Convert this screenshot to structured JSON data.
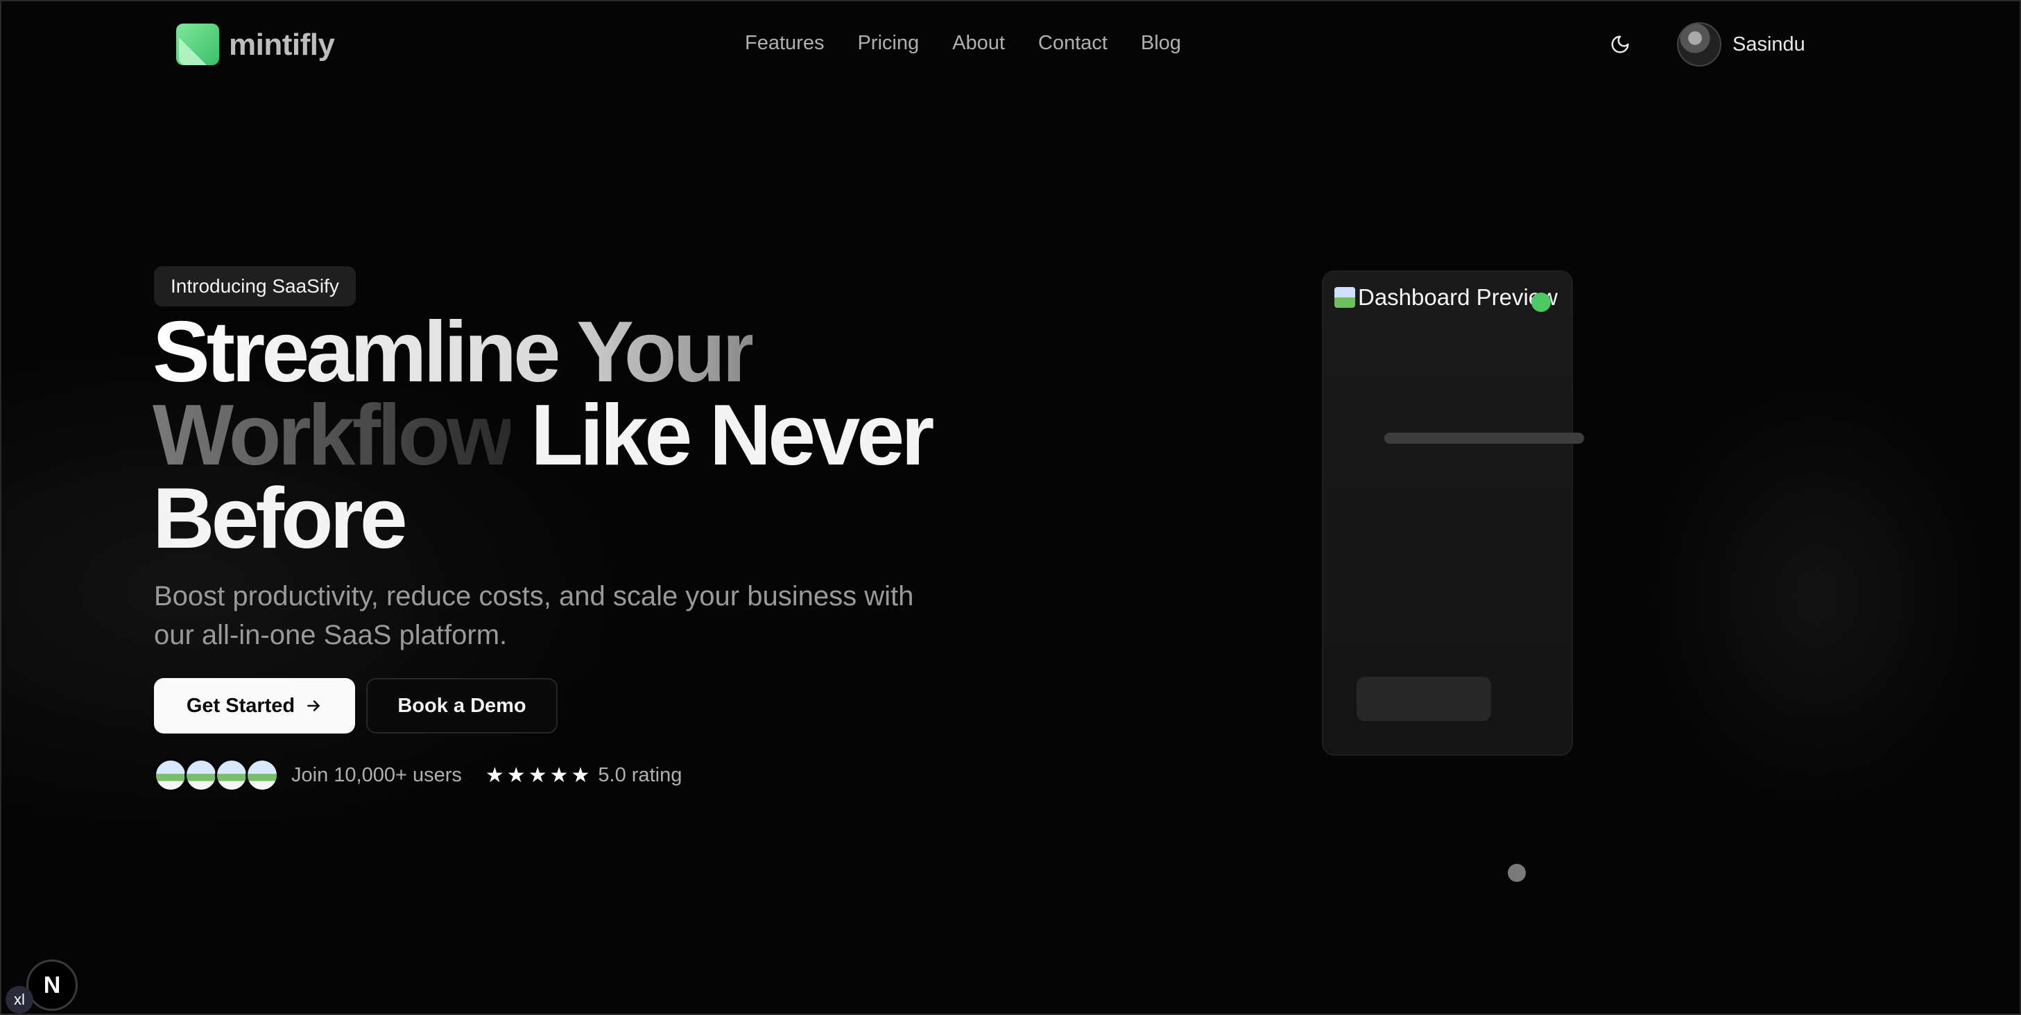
{
  "brand": {
    "name": "mintifly",
    "icon": "mintifly-logo-icon"
  },
  "nav": {
    "items": [
      {
        "label": "Features"
      },
      {
        "label": "Pricing"
      },
      {
        "label": "About"
      },
      {
        "label": "Contact"
      },
      {
        "label": "Blog"
      }
    ]
  },
  "header": {
    "theme_toggle_icon": "moon-icon",
    "user": {
      "name": "Sasindu"
    }
  },
  "hero": {
    "badge": "Introducing SaaSify",
    "headline": {
      "word1": "Streamline",
      "word2": "Your",
      "word3": "Workflow",
      "word4": "Like Never",
      "word5": "Before"
    },
    "subtitle": "Boost productivity, reduce costs, and scale your business with our all-in-one SaaS platform.",
    "primary_cta": "Get Started",
    "secondary_cta": "Book a Demo",
    "social_proof": {
      "avatar_count": 4,
      "join_text": "Join 10,000+ users",
      "stars": 5,
      "rating_text": "5.0 rating"
    }
  },
  "preview": {
    "image_alt": "Dashboard Preview"
  },
  "dev_badges": {
    "next": "N",
    "breakpoint": "xl"
  },
  "colors": {
    "background": "#050505",
    "accent_green": "#4cc865",
    "logo_green": "#7ee89a",
    "text_muted": "#9a9a9a"
  }
}
